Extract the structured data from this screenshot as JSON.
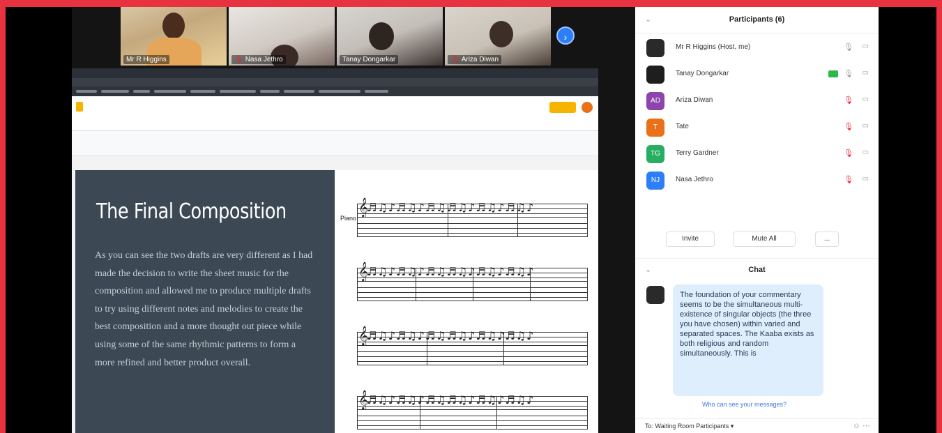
{
  "video": {
    "tiles": [
      {
        "name": "Mr R Higgins"
      },
      {
        "name": "Nasa Jethro"
      },
      {
        "name": "Tanay Dongarkar"
      },
      {
        "name": "Ariza Diwan"
      }
    ]
  },
  "document": {
    "title": "The Final Composition",
    "body": "As you can see the two drafts are very different as I had made the decision to write the sheet music for the composition and allowed me to produce multiple drafts to try using different notes and melodies to create the best composition and a more thought out piece while using some of the same rhythmic patterns to form a more refined and better product overall.",
    "instrument_label": "Piano"
  },
  "participants": {
    "title": "Participants (6)",
    "list": [
      {
        "initials": "",
        "name": "Mr R Higgins (Host, me)",
        "color": "#2a2a2a",
        "muted": false
      },
      {
        "initials": "",
        "name": "Tanay Dongarkar",
        "color": "#1e1e1e",
        "muted": false
      },
      {
        "initials": "AD",
        "name": "Ariza Diwan",
        "color": "#8e44ad",
        "muted": true
      },
      {
        "initials": "T",
        "name": "Tate",
        "color": "#e8711a",
        "muted": true
      },
      {
        "initials": "TG",
        "name": "Terry Gardner",
        "color": "#27ae60",
        "muted": true
      },
      {
        "initials": "NJ",
        "name": "Nasa Jethro",
        "color": "#2d7ff9",
        "muted": true
      }
    ],
    "invite_label": "Invite",
    "mute_all_label": "Mute All",
    "more_label": "..."
  },
  "chat": {
    "title": "Chat",
    "message": "The foundation of your commentary seems to be the simultaneous multi-existence of singular objects (the three you have chosen) within varied and separated spaces. The Kaaba exists as both religious and random simultaneously. This is",
    "who_can_see": "Who can see your messages?",
    "to_label": "To:",
    "recipient": "Waiting Room Participants"
  }
}
